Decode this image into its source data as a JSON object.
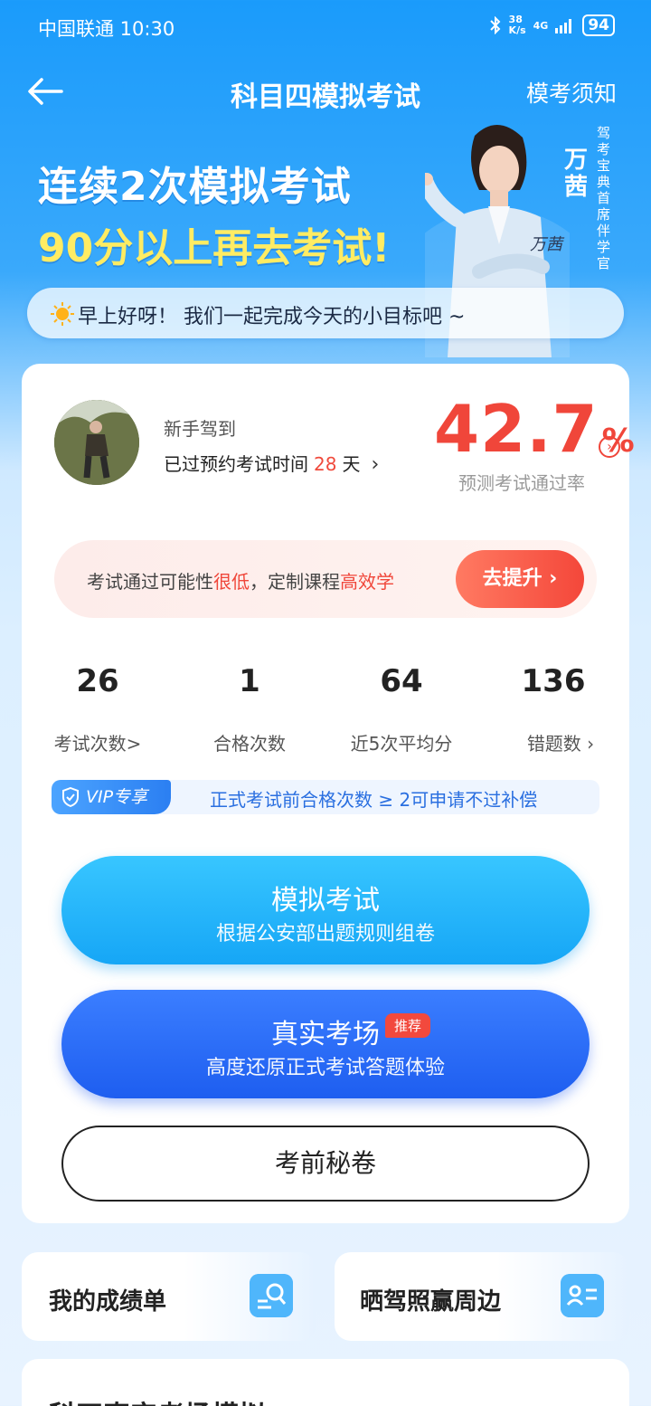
{
  "status_bar": {
    "carrier": "中国联通 10:30",
    "speed_value": "38",
    "speed_unit": "K/s",
    "network": "4G",
    "battery": "94"
  },
  "nav": {
    "back_icon": "arrow-left-icon",
    "title": "科目四模拟考试",
    "notice": "模考须知"
  },
  "banner": {
    "line1": "连续2次模拟考试",
    "line2": "90分以上再去考试!",
    "coach_name": "万茜",
    "coach_title": "驾考宝典首席伴学官",
    "signature": "万茜",
    "greeting": "早上好呀！ 我们一起完成今天的小目标吧 ~"
  },
  "profile": {
    "level": "新手驾到",
    "exam_time_prefix": "已过预约考试时间",
    "exam_days": "28",
    "exam_days_unit": "天",
    "pass_rate": "42.7",
    "pass_rate_unit": "%",
    "pass_rate_label": "预测考试通过率"
  },
  "tip": {
    "part1": "考试通过可能性",
    "part2": "很低",
    "part3": "，定制课程",
    "part4": "高效学",
    "button": "去提升 ›"
  },
  "stats": [
    {
      "value": "26",
      "label": "考试次数>"
    },
    {
      "value": "1",
      "label": "合格次数"
    },
    {
      "value": "64",
      "label": "近5次平均分"
    },
    {
      "value": "136",
      "label": "错题数 ›"
    }
  ],
  "vip": {
    "tag": "VIP专享",
    "text": "正式考试前合格次数 ≥ 2可申请不过补偿"
  },
  "buttons": {
    "mock_title": "模拟考试",
    "mock_sub": "根据公安部出题规则组卷",
    "real_title": "真实考场",
    "real_badge": "推荐",
    "real_sub": "高度还原正式考试答题体验",
    "secret": "考前秘卷"
  },
  "bottom": {
    "report": "我的成绩单",
    "share": "晒驾照赢周边",
    "peek_title": "科四真实考场模拟"
  },
  "colors": {
    "primary_blue": "#1a9bfb",
    "accent_red": "#f0463a",
    "yellow": "#ffec63"
  }
}
